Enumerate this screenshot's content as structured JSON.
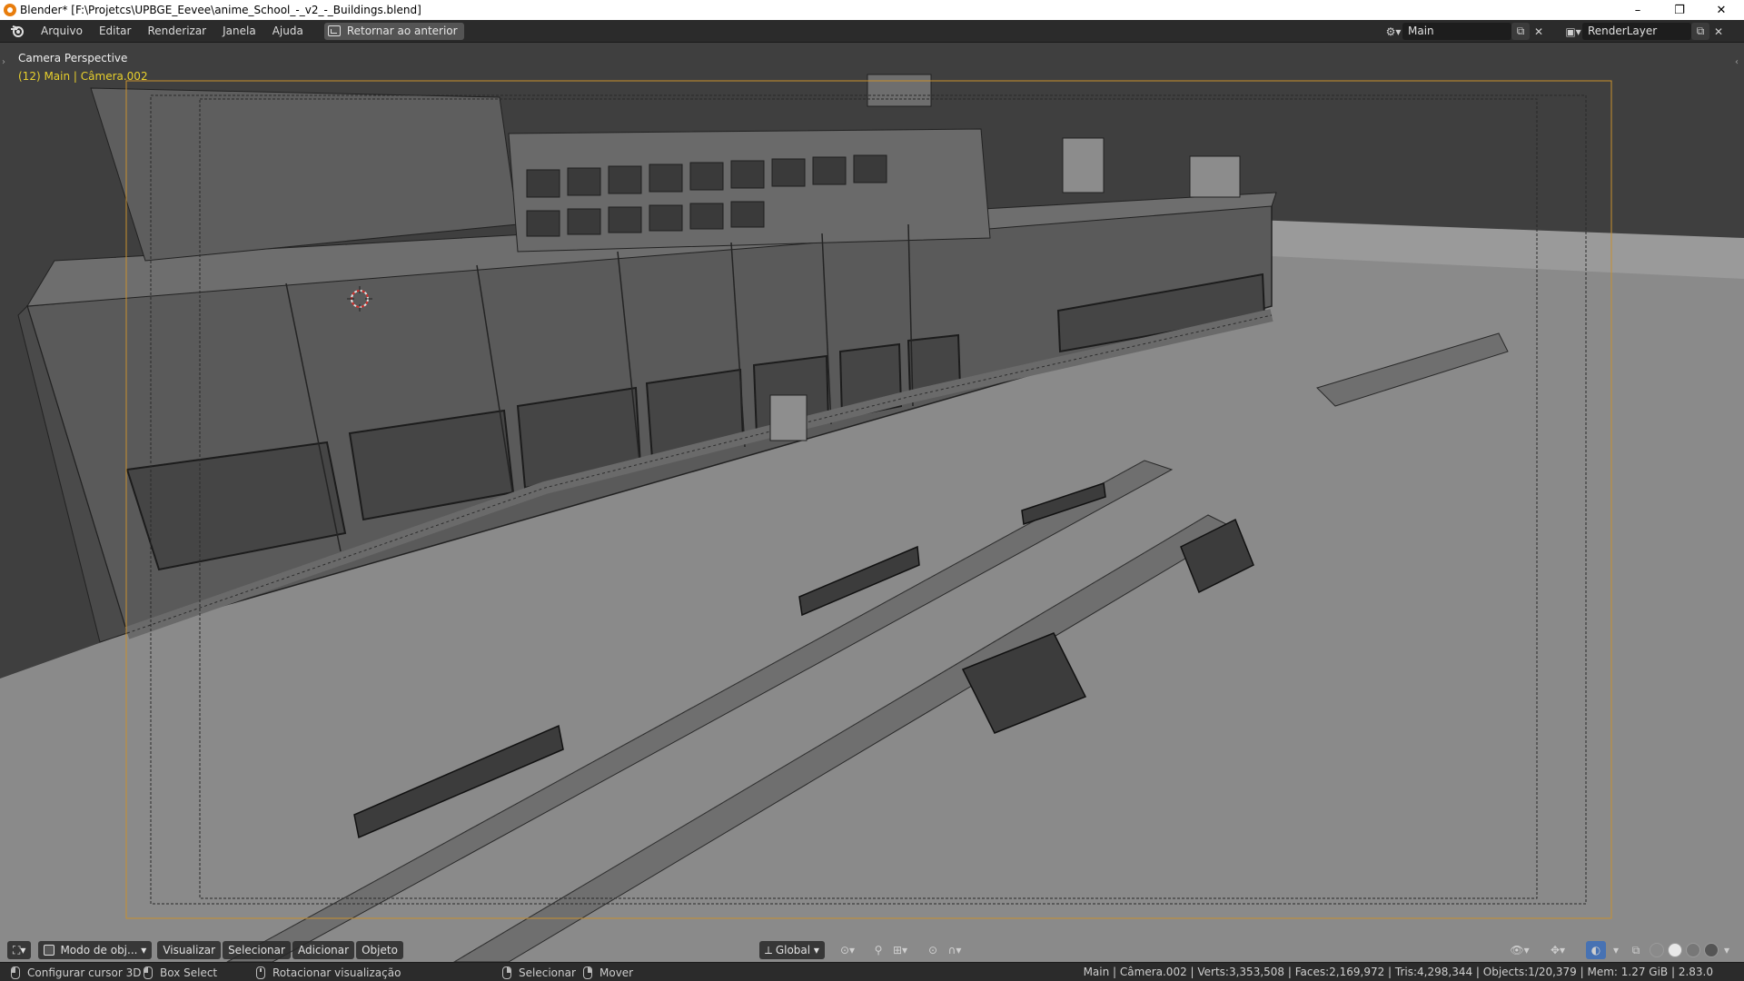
{
  "window": {
    "title": "Blender* [F:\\Projetcs\\UPBGE_Eevee\\anime_School_-_v2_-_Buildings.blend]",
    "minimize": "–",
    "maximize": "❐",
    "close": "✕"
  },
  "menu": {
    "items": [
      "Arquivo",
      "Editar",
      "Renderizar",
      "Janela",
      "Ajuda"
    ],
    "back_button": "Retornar ao anterior"
  },
  "scene": {
    "name": "Main"
  },
  "view_layer": {
    "name": "RenderLayer"
  },
  "viewport": {
    "title": "Camera Perspective",
    "subtitle": "(12) Main | Câmera.002"
  },
  "viewport_header": {
    "mode": "Modo de obj...",
    "menus": [
      "Visualizar",
      "Selecionar",
      "Adicionar",
      "Objeto"
    ],
    "orientation": "Global"
  },
  "statusbar": {
    "left_click": "Configurar cursor 3D",
    "box_select": "Box Select",
    "rotate": "Rotacionar visualização",
    "select": "Selecionar",
    "move": "Mover",
    "stats": "Main | Câmera.002 | Verts:3,353,508 | Faces:2,169,972 | Tris:4,298,344 | Objects:1/20,379 | Mem: 1.27 GiB | 2.83.0"
  },
  "colors": {
    "accent": "#e87d0d",
    "camera_frame": "#c8902e",
    "subtitle": "#e8d02c",
    "viewport_bg": "#404040"
  }
}
